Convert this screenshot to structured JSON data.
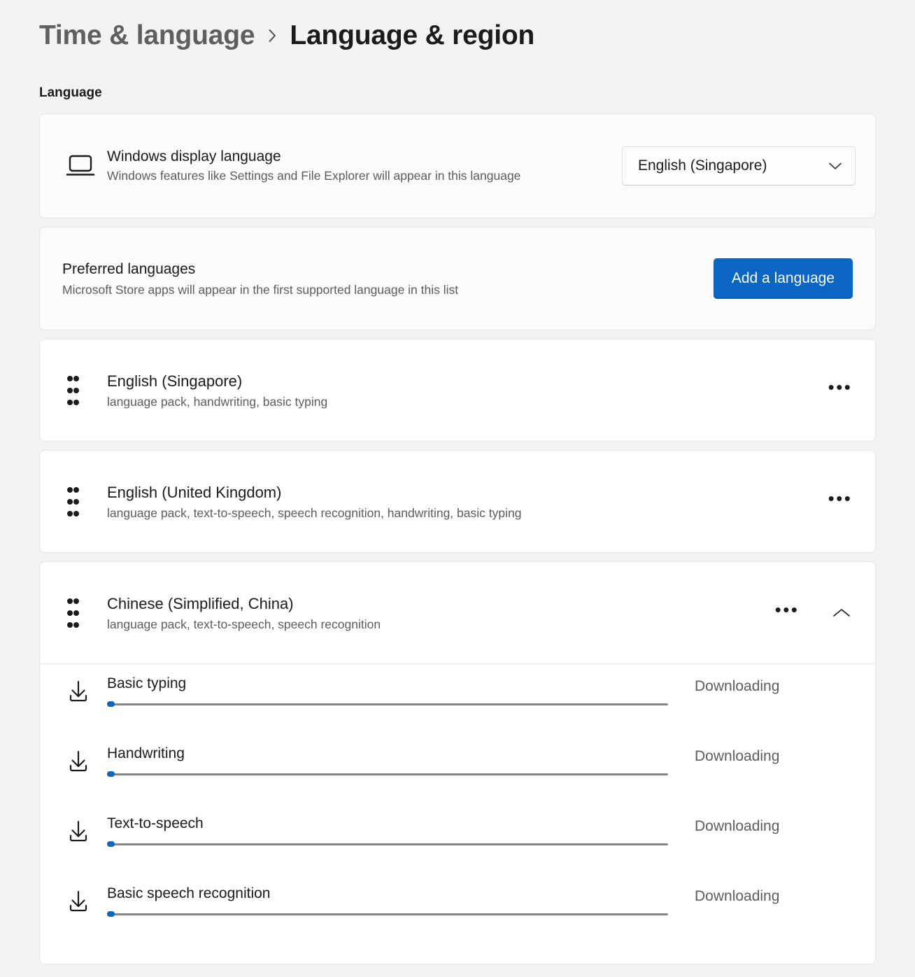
{
  "breadcrumb": {
    "parent": "Time & language",
    "separator_icon": "chevron-right-icon",
    "current": "Language & region"
  },
  "section": {
    "label": "Language"
  },
  "display_language": {
    "icon": "monitor-icon",
    "title": "Windows display language",
    "description": "Windows features like Settings and File Explorer will appear in this language",
    "dropdown": {
      "value": "English (Singapore)",
      "icon": "chevron-down-icon",
      "options": [
        "English (Singapore)"
      ]
    }
  },
  "preferred_languages": {
    "title": "Preferred languages",
    "description": "Microsoft Store apps will appear in the first supported language in this list",
    "add_button": "Add a language"
  },
  "languages": [
    {
      "name": "English (Singapore)",
      "features": "language pack, handwriting, basic typing",
      "more_label": "•••",
      "expanded": false
    },
    {
      "name": "English (United Kingdom)",
      "features": "language pack, text-to-speech, speech recognition, handwriting, basic typing",
      "more_label": "•••",
      "expanded": false
    },
    {
      "name": "Chinese (Simplified, China)",
      "features": "language pack, text-to-speech, speech recognition",
      "more_label": "•••",
      "expanded": true,
      "collapse_icon": "chevron-up-icon"
    }
  ],
  "downloads": [
    {
      "icon": "download-icon",
      "name": "Basic typing",
      "status": "Downloading",
      "progress": 1
    },
    {
      "icon": "download-icon",
      "name": "Handwriting",
      "status": "Downloading",
      "progress": 1
    },
    {
      "icon": "download-icon",
      "name": "Text-to-speech",
      "status": "Downloading",
      "progress": 1
    },
    {
      "icon": "download-icon",
      "name": "Basic speech recognition",
      "status": "Downloading",
      "progress": 1
    }
  ],
  "colors": {
    "accent": "#0a66c2",
    "page_background": "#f3f3f3",
    "card_background": "#fbfbfb",
    "text_primary": "#1b1b1b",
    "text_secondary": "#5d5d5d",
    "progress_track": "#868686"
  }
}
